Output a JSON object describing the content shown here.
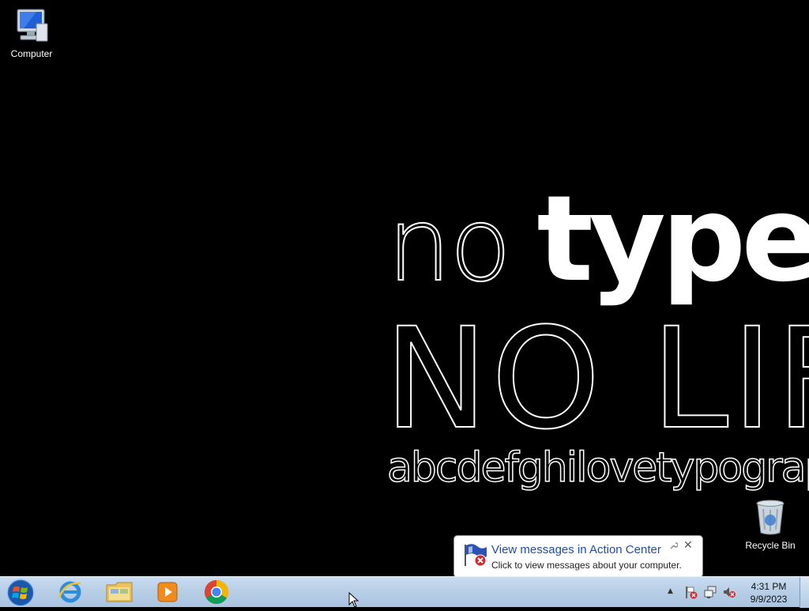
{
  "wallpaper": {
    "line1_light": "no",
    "line1_bold": "type",
    "line2": "NO LIFE",
    "line3": "abcdefghilovetypography.com"
  },
  "desktop_icons": [
    {
      "label": "Computer",
      "icon": "computer-icon"
    },
    {
      "label": "Recycle Bin",
      "icon": "recycle-bin-icon"
    }
  ],
  "notification": {
    "title": "View messages in Action Center",
    "text": "Click to view messages about your computer.",
    "close_label": "✕",
    "icon": "action-center-flag-icon"
  },
  "taskbar": {
    "pinned": [
      {
        "name": "Internet Explorer",
        "icon": "internet-explorer-icon"
      },
      {
        "name": "Windows Explorer",
        "icon": "file-explorer-icon"
      },
      {
        "name": "Windows Media Player",
        "icon": "media-player-icon"
      },
      {
        "name": "Google Chrome",
        "icon": "chrome-icon"
      }
    ],
    "tray": {
      "show_hidden_label": "▲",
      "icons": [
        "action-center-flag-icon",
        "network-icon",
        "volume-muted-icon"
      ]
    },
    "clock": {
      "time": "4:31 PM",
      "date": "9/9/2023"
    }
  },
  "colors": {
    "desktop_bg": "#000000",
    "taskbar_top": "#c9dcef",
    "taskbar_bottom": "#a9c3e0",
    "balloon_title": "#1e4fa8"
  }
}
